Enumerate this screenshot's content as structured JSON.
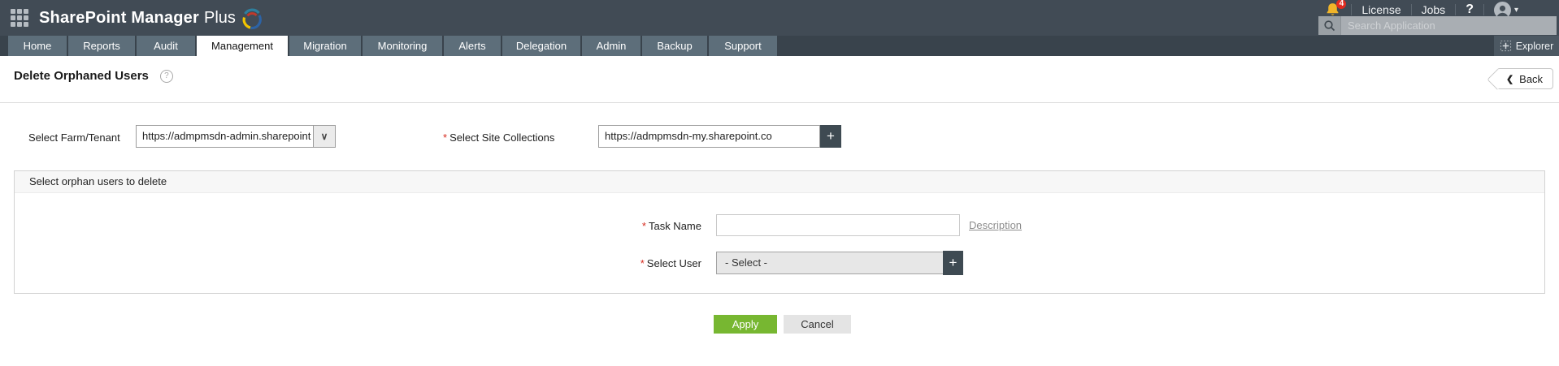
{
  "icons": {
    "caret_down": "▾",
    "chevron_down": "∨",
    "plus": "+",
    "back_chevron": "❮",
    "help_glyph": "?"
  },
  "colors": {
    "topbar_bg": "#414b55",
    "nav_bg": "#39434c",
    "nav_tab_bg": "#5d6e7a",
    "dark_button": "#3e4a52",
    "apply_green": "#77b731",
    "bell_gold": "#f0b429",
    "badge_red": "#e02b20"
  },
  "header": {
    "app_title_main": "SharePoint Manager",
    "app_title_suffix": "Plus",
    "notification_count": "4",
    "license_label": "License",
    "jobs_label": "Jobs",
    "help_label": "?",
    "search_placeholder": "Search Application"
  },
  "nav": {
    "tabs": [
      {
        "label": "Home",
        "active": false
      },
      {
        "label": "Reports",
        "active": false
      },
      {
        "label": "Audit",
        "active": false
      },
      {
        "label": "Management",
        "active": true
      },
      {
        "label": "Migration",
        "active": false
      },
      {
        "label": "Monitoring",
        "active": false
      },
      {
        "label": "Alerts",
        "active": false
      },
      {
        "label": "Delegation",
        "active": false
      },
      {
        "label": "Admin",
        "active": false
      },
      {
        "label": "Backup",
        "active": false
      },
      {
        "label": "Support",
        "active": false
      }
    ],
    "explorer_label": "Explorer"
  },
  "page": {
    "title": "Delete Orphaned Users",
    "back_label": "Back"
  },
  "form": {
    "required_marker": "*",
    "farm_label": "Select Farm/Tenant",
    "farm_value": "https://admpmsdn-admin.sharepoint",
    "site_label": "Select Site Collections",
    "site_value": "https://admpmsdn-my.sharepoint.co",
    "panel_title": "Select orphan users to delete",
    "task_name_label": "Task Name",
    "task_name_value": "",
    "description_link": "Description",
    "user_label": "Select User",
    "user_value": "- Select -",
    "apply_label": "Apply",
    "cancel_label": "Cancel"
  }
}
